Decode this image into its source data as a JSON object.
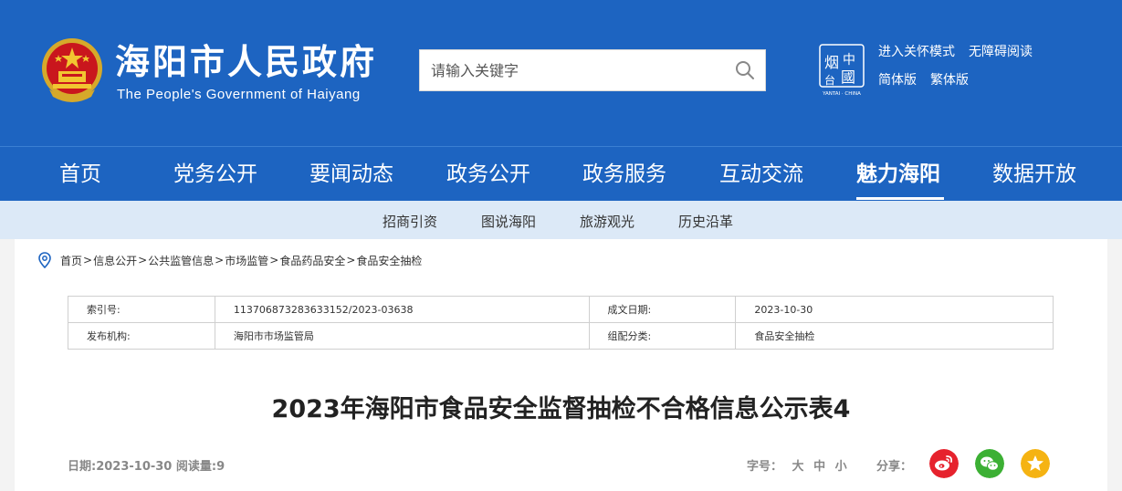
{
  "header": {
    "title": "海阳市人民政府",
    "subtitle": "The People's Government of Haiyang",
    "search_placeholder": "请输入关键字",
    "tools": [
      "进入关怀模式",
      "无障碍阅读",
      "简体版",
      "繁体版"
    ],
    "logo_caption": "YANTAI · CHINA"
  },
  "nav": {
    "items": [
      "首页",
      "党务公开",
      "要闻动态",
      "政务公开",
      "政务服务",
      "互动交流",
      "魅力海阳",
      "数据开放"
    ],
    "active": "魅力海阳"
  },
  "subnav": {
    "items": [
      "招商引资",
      "图说海阳",
      "旅游观光",
      "历史沿革"
    ]
  },
  "breadcrumb": [
    "首页",
    "信息公开",
    "公共监管信息",
    "市场监管",
    "食品药品安全",
    "食品安全抽检"
  ],
  "meta": {
    "rows": [
      {
        "k1": "索引号:",
        "v1": "113706873283633152/2023-03638",
        "k2": "成文日期:",
        "v2": "2023-10-30"
      },
      {
        "k1": "发布机构:",
        "v1": "海阳市市场监管局",
        "k2": "组配分类:",
        "v2": "食品安全抽检"
      }
    ]
  },
  "article": {
    "title": "2023年海阳市食品安全监督抽检不合格信息公示表4",
    "info": "日期:2023-10-30 阅读量:9",
    "font_label": "字号：",
    "font_sizes": [
      "大",
      "中",
      "小"
    ],
    "share_label": "分享："
  },
  "colors": {
    "header_bg": "#1d64c1",
    "subnav_bg": "#dce9f7",
    "weibo": "#e6222d",
    "wechat": "#3cb034",
    "favorite": "#f5b312"
  }
}
